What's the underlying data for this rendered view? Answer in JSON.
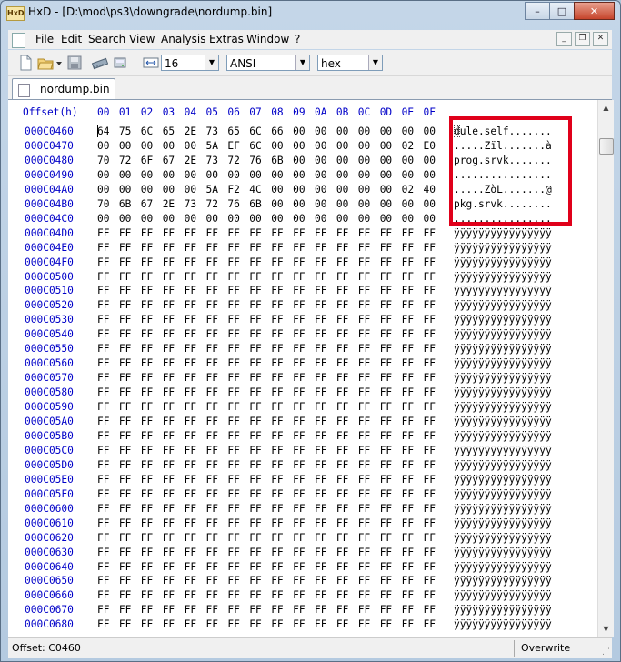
{
  "window": {
    "title": "HxD - [D:\\mod\\ps3\\downgrade\\nordump.bin]",
    "app_badge": "HxD",
    "controls": {
      "minimize": "–",
      "maximize": "□",
      "close": "✕"
    }
  },
  "menu": {
    "items": [
      "File",
      "Edit",
      "Search",
      "View",
      "Analysis",
      "Extras",
      "Window",
      "?"
    ],
    "mdi": {
      "minimize": "_",
      "restore": "❐",
      "close": "✕"
    }
  },
  "toolbar": {
    "bytes_per_row": "16",
    "charset": "ANSI",
    "offset_base": "hex",
    "icons": [
      "new-file-icon",
      "open-folder-icon",
      "save-icon",
      "ram-icon",
      "disk-icon",
      "columns-icon"
    ]
  },
  "tab": {
    "label": "nordump.bin"
  },
  "editor": {
    "offset_header": "Offset(h)",
    "columns": [
      "00",
      "01",
      "02",
      "03",
      "04",
      "05",
      "06",
      "07",
      "08",
      "09",
      "0A",
      "0B",
      "0C",
      "0D",
      "0E",
      "0F"
    ],
    "rows": [
      {
        "offset": "000C0460",
        "bytes": [
          "64",
          "75",
          "6C",
          "65",
          "2E",
          "73",
          "65",
          "6C",
          "66",
          "00",
          "00",
          "00",
          "00",
          "00",
          "00",
          "00"
        ],
        "text": "dule.self......."
      },
      {
        "offset": "000C0470",
        "bytes": [
          "00",
          "00",
          "00",
          "00",
          "00",
          "5A",
          "EF",
          "6C",
          "00",
          "00",
          "00",
          "00",
          "00",
          "00",
          "02",
          "E0"
        ],
        "text": ".....Zïl.......à"
      },
      {
        "offset": "000C0480",
        "bytes": [
          "70",
          "72",
          "6F",
          "67",
          "2E",
          "73",
          "72",
          "76",
          "6B",
          "00",
          "00",
          "00",
          "00",
          "00",
          "00",
          "00"
        ],
        "text": "prog.srvk......."
      },
      {
        "offset": "000C0490",
        "bytes": [
          "00",
          "00",
          "00",
          "00",
          "00",
          "00",
          "00",
          "00",
          "00",
          "00",
          "00",
          "00",
          "00",
          "00",
          "00",
          "00"
        ],
        "text": "................"
      },
      {
        "offset": "000C04A0",
        "bytes": [
          "00",
          "00",
          "00",
          "00",
          "00",
          "5A",
          "F2",
          "4C",
          "00",
          "00",
          "00",
          "00",
          "00",
          "00",
          "02",
          "40"
        ],
        "text": ".....ZòL.......@"
      },
      {
        "offset": "000C04B0",
        "bytes": [
          "70",
          "6B",
          "67",
          "2E",
          "73",
          "72",
          "76",
          "6B",
          "00",
          "00",
          "00",
          "00",
          "00",
          "00",
          "00",
          "00"
        ],
        "text": "pkg.srvk........"
      },
      {
        "offset": "000C04C0",
        "bytes": [
          "00",
          "00",
          "00",
          "00",
          "00",
          "00",
          "00",
          "00",
          "00",
          "00",
          "00",
          "00",
          "00",
          "00",
          "00",
          "00"
        ],
        "text": "................"
      },
      {
        "offset": "000C04D0",
        "bytes": [
          "FF",
          "FF",
          "FF",
          "FF",
          "FF",
          "FF",
          "FF",
          "FF",
          "FF",
          "FF",
          "FF",
          "FF",
          "FF",
          "FF",
          "FF",
          "FF"
        ],
        "text": "ÿÿÿÿÿÿÿÿÿÿÿÿÿÿÿÿ"
      },
      {
        "offset": "000C04E0",
        "bytes": [
          "FF",
          "FF",
          "FF",
          "FF",
          "FF",
          "FF",
          "FF",
          "FF",
          "FF",
          "FF",
          "FF",
          "FF",
          "FF",
          "FF",
          "FF",
          "FF"
        ],
        "text": "ÿÿÿÿÿÿÿÿÿÿÿÿÿÿÿÿ"
      },
      {
        "offset": "000C04F0",
        "bytes": [
          "FF",
          "FF",
          "FF",
          "FF",
          "FF",
          "FF",
          "FF",
          "FF",
          "FF",
          "FF",
          "FF",
          "FF",
          "FF",
          "FF",
          "FF",
          "FF"
        ],
        "text": "ÿÿÿÿÿÿÿÿÿÿÿÿÿÿÿÿ"
      },
      {
        "offset": "000C0500",
        "bytes": [
          "FF",
          "FF",
          "FF",
          "FF",
          "FF",
          "FF",
          "FF",
          "FF",
          "FF",
          "FF",
          "FF",
          "FF",
          "FF",
          "FF",
          "FF",
          "FF"
        ],
        "text": "ÿÿÿÿÿÿÿÿÿÿÿÿÿÿÿÿ"
      },
      {
        "offset": "000C0510",
        "bytes": [
          "FF",
          "FF",
          "FF",
          "FF",
          "FF",
          "FF",
          "FF",
          "FF",
          "FF",
          "FF",
          "FF",
          "FF",
          "FF",
          "FF",
          "FF",
          "FF"
        ],
        "text": "ÿÿÿÿÿÿÿÿÿÿÿÿÿÿÿÿ"
      },
      {
        "offset": "000C0520",
        "bytes": [
          "FF",
          "FF",
          "FF",
          "FF",
          "FF",
          "FF",
          "FF",
          "FF",
          "FF",
          "FF",
          "FF",
          "FF",
          "FF",
          "FF",
          "FF",
          "FF"
        ],
        "text": "ÿÿÿÿÿÿÿÿÿÿÿÿÿÿÿÿ"
      },
      {
        "offset": "000C0530",
        "bytes": [
          "FF",
          "FF",
          "FF",
          "FF",
          "FF",
          "FF",
          "FF",
          "FF",
          "FF",
          "FF",
          "FF",
          "FF",
          "FF",
          "FF",
          "FF",
          "FF"
        ],
        "text": "ÿÿÿÿÿÿÿÿÿÿÿÿÿÿÿÿ"
      },
      {
        "offset": "000C0540",
        "bytes": [
          "FF",
          "FF",
          "FF",
          "FF",
          "FF",
          "FF",
          "FF",
          "FF",
          "FF",
          "FF",
          "FF",
          "FF",
          "FF",
          "FF",
          "FF",
          "FF"
        ],
        "text": "ÿÿÿÿÿÿÿÿÿÿÿÿÿÿÿÿ"
      },
      {
        "offset": "000C0550",
        "bytes": [
          "FF",
          "FF",
          "FF",
          "FF",
          "FF",
          "FF",
          "FF",
          "FF",
          "FF",
          "FF",
          "FF",
          "FF",
          "FF",
          "FF",
          "FF",
          "FF"
        ],
        "text": "ÿÿÿÿÿÿÿÿÿÿÿÿÿÿÿÿ"
      },
      {
        "offset": "000C0560",
        "bytes": [
          "FF",
          "FF",
          "FF",
          "FF",
          "FF",
          "FF",
          "FF",
          "FF",
          "FF",
          "FF",
          "FF",
          "FF",
          "FF",
          "FF",
          "FF",
          "FF"
        ],
        "text": "ÿÿÿÿÿÿÿÿÿÿÿÿÿÿÿÿ"
      },
      {
        "offset": "000C0570",
        "bytes": [
          "FF",
          "FF",
          "FF",
          "FF",
          "FF",
          "FF",
          "FF",
          "FF",
          "FF",
          "FF",
          "FF",
          "FF",
          "FF",
          "FF",
          "FF",
          "FF"
        ],
        "text": "ÿÿÿÿÿÿÿÿÿÿÿÿÿÿÿÿ"
      },
      {
        "offset": "000C0580",
        "bytes": [
          "FF",
          "FF",
          "FF",
          "FF",
          "FF",
          "FF",
          "FF",
          "FF",
          "FF",
          "FF",
          "FF",
          "FF",
          "FF",
          "FF",
          "FF",
          "FF"
        ],
        "text": "ÿÿÿÿÿÿÿÿÿÿÿÿÿÿÿÿ"
      },
      {
        "offset": "000C0590",
        "bytes": [
          "FF",
          "FF",
          "FF",
          "FF",
          "FF",
          "FF",
          "FF",
          "FF",
          "FF",
          "FF",
          "FF",
          "FF",
          "FF",
          "FF",
          "FF",
          "FF"
        ],
        "text": "ÿÿÿÿÿÿÿÿÿÿÿÿÿÿÿÿ"
      },
      {
        "offset": "000C05A0",
        "bytes": [
          "FF",
          "FF",
          "FF",
          "FF",
          "FF",
          "FF",
          "FF",
          "FF",
          "FF",
          "FF",
          "FF",
          "FF",
          "FF",
          "FF",
          "FF",
          "FF"
        ],
        "text": "ÿÿÿÿÿÿÿÿÿÿÿÿÿÿÿÿ"
      },
      {
        "offset": "000C05B0",
        "bytes": [
          "FF",
          "FF",
          "FF",
          "FF",
          "FF",
          "FF",
          "FF",
          "FF",
          "FF",
          "FF",
          "FF",
          "FF",
          "FF",
          "FF",
          "FF",
          "FF"
        ],
        "text": "ÿÿÿÿÿÿÿÿÿÿÿÿÿÿÿÿ"
      },
      {
        "offset": "000C05C0",
        "bytes": [
          "FF",
          "FF",
          "FF",
          "FF",
          "FF",
          "FF",
          "FF",
          "FF",
          "FF",
          "FF",
          "FF",
          "FF",
          "FF",
          "FF",
          "FF",
          "FF"
        ],
        "text": "ÿÿÿÿÿÿÿÿÿÿÿÿÿÿÿÿ"
      },
      {
        "offset": "000C05D0",
        "bytes": [
          "FF",
          "FF",
          "FF",
          "FF",
          "FF",
          "FF",
          "FF",
          "FF",
          "FF",
          "FF",
          "FF",
          "FF",
          "FF",
          "FF",
          "FF",
          "FF"
        ],
        "text": "ÿÿÿÿÿÿÿÿÿÿÿÿÿÿÿÿ"
      },
      {
        "offset": "000C05E0",
        "bytes": [
          "FF",
          "FF",
          "FF",
          "FF",
          "FF",
          "FF",
          "FF",
          "FF",
          "FF",
          "FF",
          "FF",
          "FF",
          "FF",
          "FF",
          "FF",
          "FF"
        ],
        "text": "ÿÿÿÿÿÿÿÿÿÿÿÿÿÿÿÿ"
      },
      {
        "offset": "000C05F0",
        "bytes": [
          "FF",
          "FF",
          "FF",
          "FF",
          "FF",
          "FF",
          "FF",
          "FF",
          "FF",
          "FF",
          "FF",
          "FF",
          "FF",
          "FF",
          "FF",
          "FF"
        ],
        "text": "ÿÿÿÿÿÿÿÿÿÿÿÿÿÿÿÿ"
      },
      {
        "offset": "000C0600",
        "bytes": [
          "FF",
          "FF",
          "FF",
          "FF",
          "FF",
          "FF",
          "FF",
          "FF",
          "FF",
          "FF",
          "FF",
          "FF",
          "FF",
          "FF",
          "FF",
          "FF"
        ],
        "text": "ÿÿÿÿÿÿÿÿÿÿÿÿÿÿÿÿ"
      },
      {
        "offset": "000C0610",
        "bytes": [
          "FF",
          "FF",
          "FF",
          "FF",
          "FF",
          "FF",
          "FF",
          "FF",
          "FF",
          "FF",
          "FF",
          "FF",
          "FF",
          "FF",
          "FF",
          "FF"
        ],
        "text": "ÿÿÿÿÿÿÿÿÿÿÿÿÿÿÿÿ"
      },
      {
        "offset": "000C0620",
        "bytes": [
          "FF",
          "FF",
          "FF",
          "FF",
          "FF",
          "FF",
          "FF",
          "FF",
          "FF",
          "FF",
          "FF",
          "FF",
          "FF",
          "FF",
          "FF",
          "FF"
        ],
        "text": "ÿÿÿÿÿÿÿÿÿÿÿÿÿÿÿÿ"
      },
      {
        "offset": "000C0630",
        "bytes": [
          "FF",
          "FF",
          "FF",
          "FF",
          "FF",
          "FF",
          "FF",
          "FF",
          "FF",
          "FF",
          "FF",
          "FF",
          "FF",
          "FF",
          "FF",
          "FF"
        ],
        "text": "ÿÿÿÿÿÿÿÿÿÿÿÿÿÿÿÿ"
      },
      {
        "offset": "000C0640",
        "bytes": [
          "FF",
          "FF",
          "FF",
          "FF",
          "FF",
          "FF",
          "FF",
          "FF",
          "FF",
          "FF",
          "FF",
          "FF",
          "FF",
          "FF",
          "FF",
          "FF"
        ],
        "text": "ÿÿÿÿÿÿÿÿÿÿÿÿÿÿÿÿ"
      },
      {
        "offset": "000C0650",
        "bytes": [
          "FF",
          "FF",
          "FF",
          "FF",
          "FF",
          "FF",
          "FF",
          "FF",
          "FF",
          "FF",
          "FF",
          "FF",
          "FF",
          "FF",
          "FF",
          "FF"
        ],
        "text": "ÿÿÿÿÿÿÿÿÿÿÿÿÿÿÿÿ"
      },
      {
        "offset": "000C0660",
        "bytes": [
          "FF",
          "FF",
          "FF",
          "FF",
          "FF",
          "FF",
          "FF",
          "FF",
          "FF",
          "FF",
          "FF",
          "FF",
          "FF",
          "FF",
          "FF",
          "FF"
        ],
        "text": "ÿÿÿÿÿÿÿÿÿÿÿÿÿÿÿÿ"
      },
      {
        "offset": "000C0670",
        "bytes": [
          "FF",
          "FF",
          "FF",
          "FF",
          "FF",
          "FF",
          "FF",
          "FF",
          "FF",
          "FF",
          "FF",
          "FF",
          "FF",
          "FF",
          "FF",
          "FF"
        ],
        "text": "ÿÿÿÿÿÿÿÿÿÿÿÿÿÿÿÿ"
      },
      {
        "offset": "000C0680",
        "bytes": [
          "FF",
          "FF",
          "FF",
          "FF",
          "FF",
          "FF",
          "FF",
          "FF",
          "FF",
          "FF",
          "FF",
          "FF",
          "FF",
          "FF",
          "FF",
          "FF"
        ],
        "text": "ÿÿÿÿÿÿÿÿÿÿÿÿÿÿÿÿ"
      }
    ],
    "highlight_color": "#e0001a"
  },
  "scrollbar": {
    "up": "▲",
    "down": "▼"
  },
  "status": {
    "offset": "Offset: C0460",
    "mode": "Overwrite"
  }
}
